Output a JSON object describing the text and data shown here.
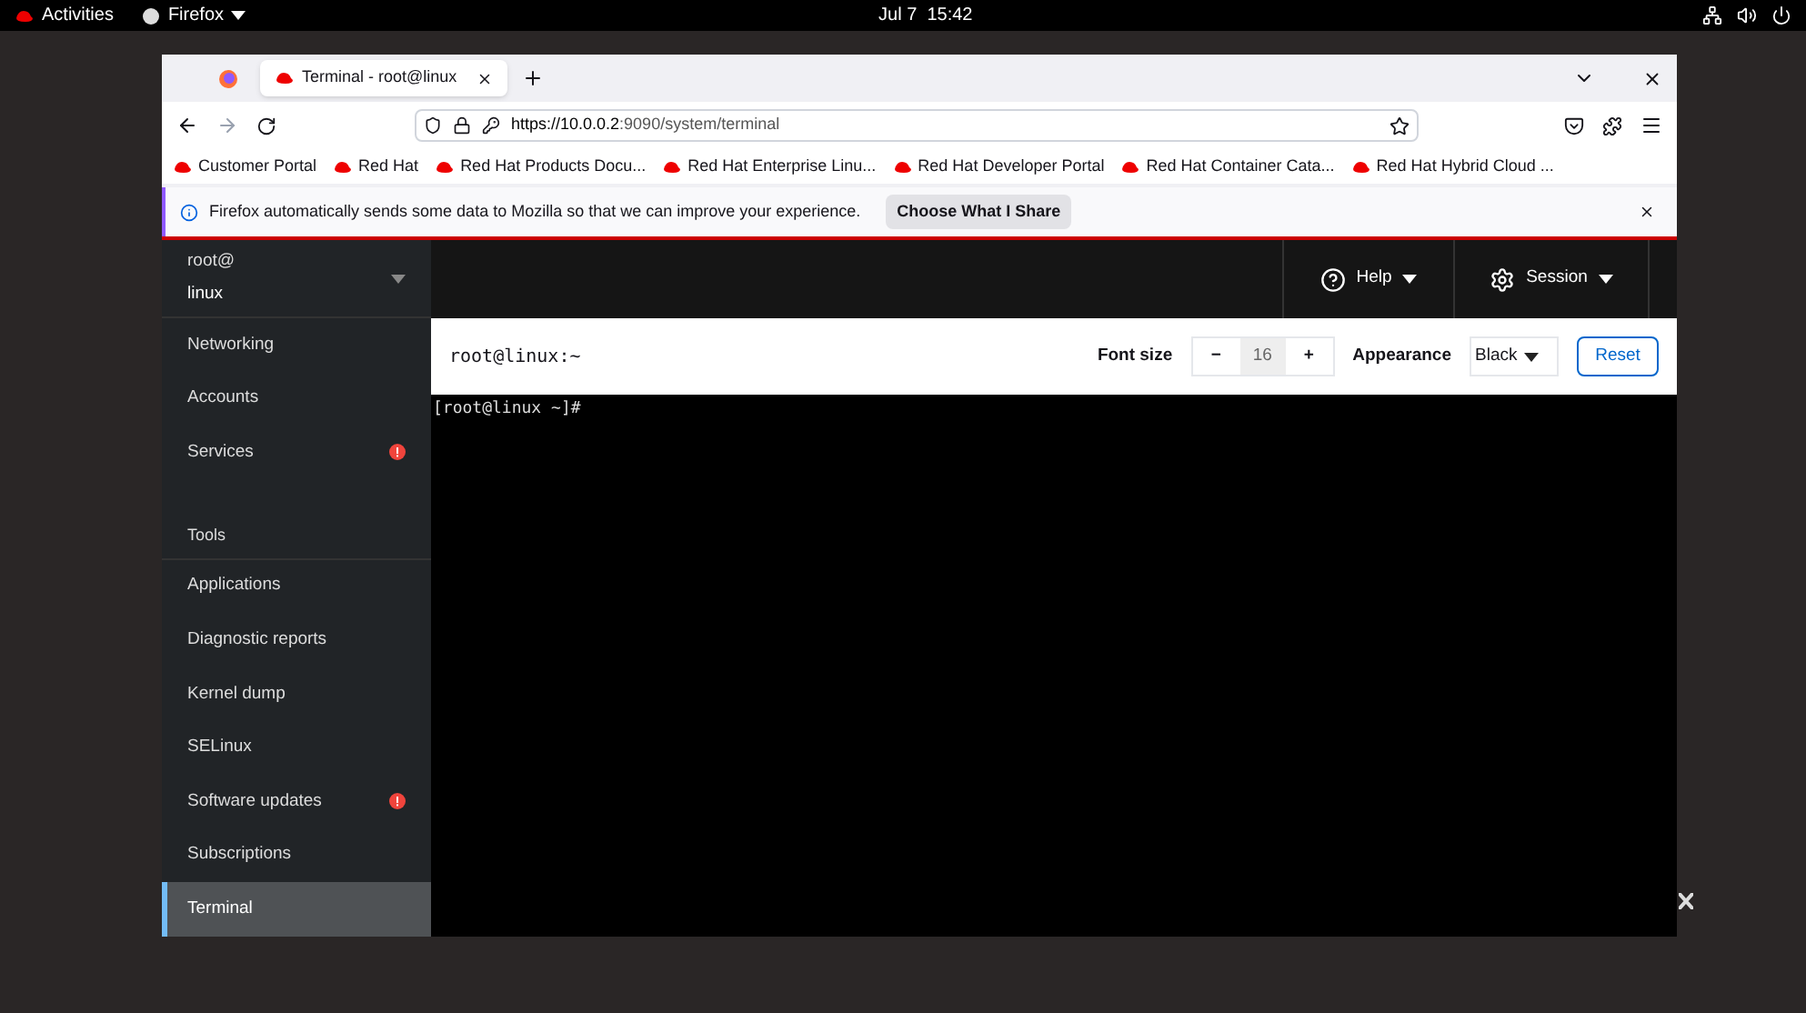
{
  "topbar": {
    "activities": "Activities",
    "app": "Firefox",
    "clock": "Jul 7  15:42"
  },
  "browser": {
    "tabs": [
      {
        "label": "Terminal - root@linux",
        "selected": true
      }
    ],
    "url": {
      "host": "https://10.0.0.2",
      "rest": ":9090/system/terminal"
    },
    "bookmarks": [
      "Customer Portal",
      "Red Hat",
      "Red Hat Products Docu...",
      "Red Hat Enterprise Linu...",
      "Red Hat Developer Portal",
      "Red Hat Container Cata...",
      "Red Hat Hybrid Cloud ..."
    ],
    "notification": {
      "text": "Firefox automatically sends some data to Mozilla so that we can improve your experience.",
      "button": "Choose What I Share"
    }
  },
  "sidebar": {
    "host": {
      "user": "root@",
      "name": "linux"
    },
    "items": [
      {
        "kind": "item",
        "label": "Networking",
        "selected": false,
        "alert": false
      },
      {
        "kind": "item",
        "label": "Accounts",
        "selected": false,
        "alert": false
      },
      {
        "kind": "item",
        "label": "Services",
        "selected": false,
        "alert": true
      },
      {
        "kind": "heading",
        "label": "Tools"
      },
      {
        "kind": "item",
        "label": "Applications",
        "selected": false,
        "alert": false
      },
      {
        "kind": "item",
        "label": "Diagnostic reports",
        "selected": false,
        "alert": false
      },
      {
        "kind": "item",
        "label": "Kernel dump",
        "selected": false,
        "alert": false
      },
      {
        "kind": "item",
        "label": "SELinux",
        "selected": false,
        "alert": false
      },
      {
        "kind": "item",
        "label": "Software updates",
        "selected": false,
        "alert": true
      },
      {
        "kind": "item",
        "label": "Subscriptions",
        "selected": false,
        "alert": false
      },
      {
        "kind": "item",
        "label": "Terminal",
        "selected": true,
        "alert": false
      }
    ]
  },
  "header": {
    "help": "Help",
    "session": "Session"
  },
  "terminal": {
    "title": "root@linux:~",
    "font_size_label": "Font size",
    "font_size": "16",
    "minus": "−",
    "plus": "+",
    "appearance_label": "Appearance",
    "appearance": "Black",
    "reset": "Reset",
    "prompt": "[root@linux ~]#"
  }
}
